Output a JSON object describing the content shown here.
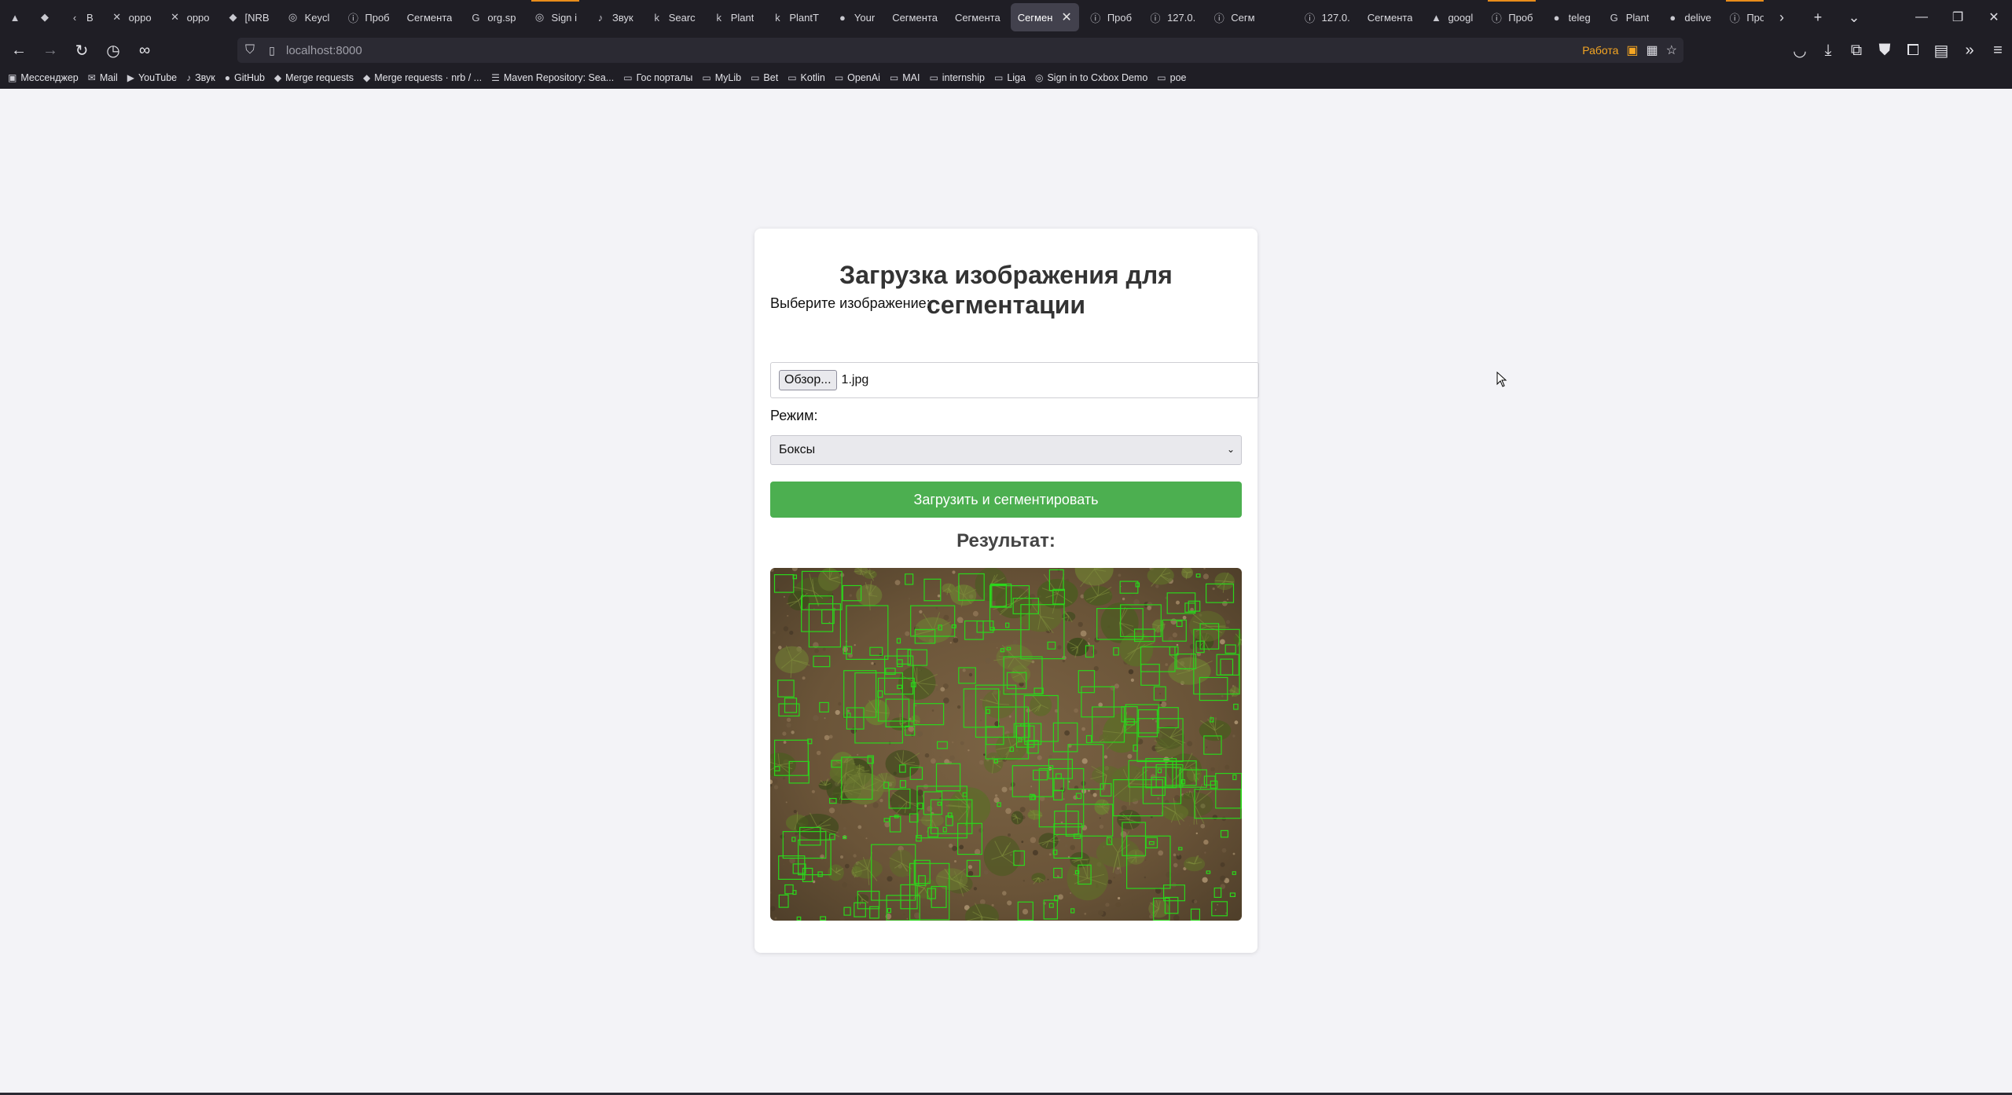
{
  "browser": {
    "tabs": [
      {
        "icon": "triangle-icon",
        "glyph": "▲",
        "label": ""
      },
      {
        "icon": "jira-icon",
        "glyph": "◆",
        "label": ""
      },
      {
        "icon": "chevron-left-icon",
        "glyph": "‹",
        "label": "B"
      },
      {
        "icon": "confluence-icon",
        "glyph": "✕",
        "label": "oppo"
      },
      {
        "icon": "confluence-icon",
        "glyph": "✕",
        "label": "oppo"
      },
      {
        "icon": "jira-icon",
        "glyph": "◆",
        "label": "[NRB"
      },
      {
        "icon": "keycloak-icon",
        "glyph": "◎",
        "label": "Keycl"
      },
      {
        "icon": "info-icon",
        "glyph": "ⓘ",
        "label": "Проб"
      },
      {
        "icon": "none",
        "glyph": "",
        "label": "Сегмента"
      },
      {
        "icon": "google-icon",
        "glyph": "G",
        "label": "org.sp"
      },
      {
        "icon": "keycloak-icon",
        "glyph": "◎",
        "label": "Sign i",
        "playing": true
      },
      {
        "icon": "audio-icon",
        "glyph": "♪",
        "label": "Звук"
      },
      {
        "icon": "k-icon",
        "glyph": "k",
        "label": "Searc"
      },
      {
        "icon": "k-icon",
        "glyph": "k",
        "label": "Plant"
      },
      {
        "icon": "k-icon",
        "glyph": "k",
        "label": "PlantT"
      },
      {
        "icon": "github-icon",
        "glyph": "●",
        "label": "Your"
      },
      {
        "icon": "none",
        "glyph": "",
        "label": "Сегмента"
      },
      {
        "icon": "none",
        "glyph": "",
        "label": "Сегмента"
      },
      {
        "icon": "none",
        "glyph": "",
        "label": "Сегмен",
        "active": true
      },
      {
        "icon": "info-icon",
        "glyph": "ⓘ",
        "label": "Проб"
      },
      {
        "icon": "info-icon",
        "glyph": "ⓘ",
        "label": "127.0."
      },
      {
        "icon": "info-icon",
        "glyph": "ⓘ",
        "label": "Сегм"
      },
      {
        "gap": true
      },
      {
        "icon": "info-icon",
        "glyph": "ⓘ",
        "label": "127.0."
      },
      {
        "icon": "none",
        "glyph": "",
        "label": "Сегмента"
      },
      {
        "icon": "triangle-icon",
        "glyph": "▲",
        "label": "googl"
      },
      {
        "icon": "info-icon",
        "glyph": "ⓘ",
        "label": "Проб",
        "playing": true
      },
      {
        "icon": "github-icon",
        "glyph": "●",
        "label": "teleg"
      },
      {
        "icon": "google-icon",
        "glyph": "G",
        "label": "Plant"
      },
      {
        "icon": "github-icon",
        "glyph": "●",
        "label": "delive"
      },
      {
        "icon": "info-icon",
        "glyph": "ⓘ",
        "label": "Проб",
        "playing": true
      }
    ],
    "url": "localhost:8000",
    "container_label": "Работа",
    "container_color": "#f5a623",
    "bookmarks": [
      {
        "icon": "messenger-icon",
        "glyph": "▣",
        "label": "Мессенджер"
      },
      {
        "icon": "mail-icon",
        "glyph": "✉",
        "label": "Mail"
      },
      {
        "icon": "youtube-icon",
        "glyph": "▶",
        "label": "YouTube"
      },
      {
        "icon": "audio-icon",
        "glyph": "♪",
        "label": "Звук"
      },
      {
        "icon": "github-icon",
        "glyph": "●",
        "label": "GitHub"
      },
      {
        "icon": "gitlab-icon",
        "glyph": "◆",
        "label": "Merge requests"
      },
      {
        "icon": "gitlab-icon",
        "glyph": "◆",
        "label": "Merge requests · nrb / ..."
      },
      {
        "icon": "maven-icon",
        "glyph": "☰",
        "label": "Maven Repository: Sea..."
      },
      {
        "icon": "folder-icon",
        "glyph": "▭",
        "label": "Гос порталы"
      },
      {
        "icon": "folder-icon",
        "glyph": "▭",
        "label": "MyLib"
      },
      {
        "icon": "folder-icon",
        "glyph": "▭",
        "label": "Bet"
      },
      {
        "icon": "folder-icon",
        "glyph": "▭",
        "label": "Kotlin"
      },
      {
        "icon": "folder-icon",
        "glyph": "▭",
        "label": "OpenAi"
      },
      {
        "icon": "folder-icon",
        "glyph": "▭",
        "label": "MAI"
      },
      {
        "icon": "folder-icon",
        "glyph": "▭",
        "label": "internship"
      },
      {
        "icon": "folder-icon",
        "glyph": "▭",
        "label": "Liga"
      },
      {
        "icon": "keycloak-icon",
        "glyph": "◎",
        "label": "Sign in to Cxbox Demo"
      },
      {
        "icon": "folder-icon",
        "glyph": "▭",
        "label": "poe"
      }
    ]
  },
  "page": {
    "title": "Загрузка изображения для сегментации",
    "file_label": "Выберите изображение:",
    "browse_label": "Обзор...",
    "file_name": "1.jpg",
    "mode_label": "Режим:",
    "mode_selected": "Боксы",
    "submit_label": "Загрузить и сегментировать",
    "result_title": "Результат:",
    "accent_color": "#4caf50",
    "result_image": "grass-soil-photo-with-green-bounding-boxes"
  }
}
